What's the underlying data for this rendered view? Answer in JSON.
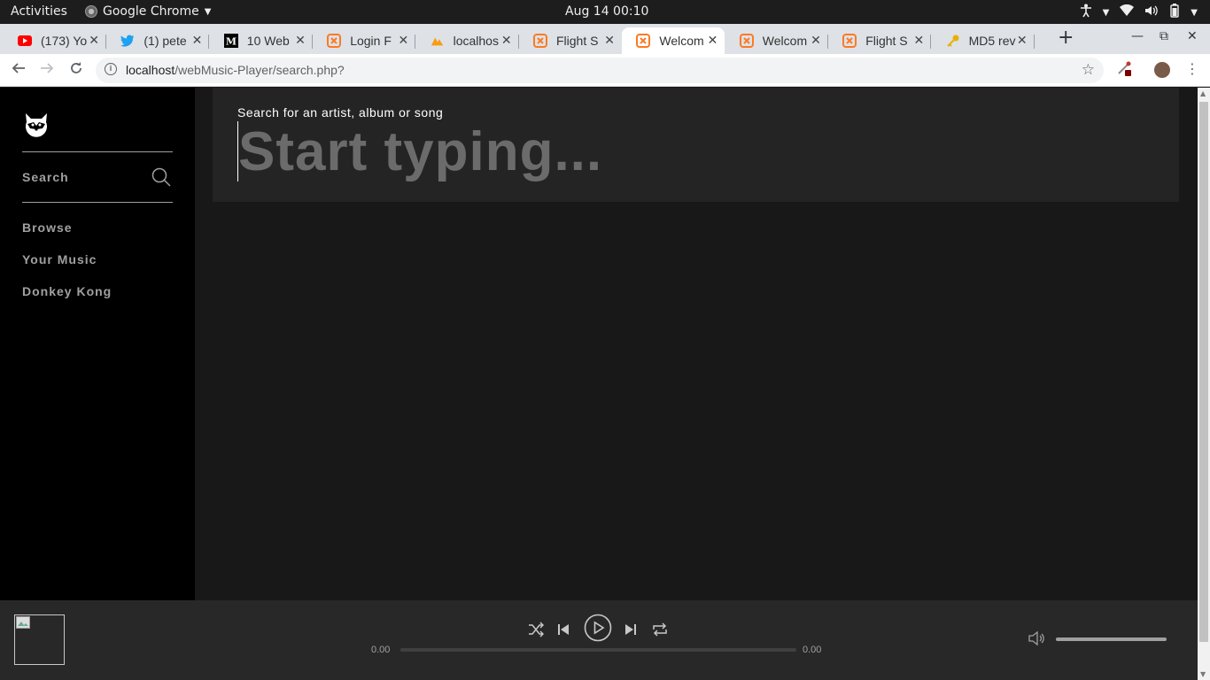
{
  "os": {
    "activities": "Activities",
    "app_name": "Google Chrome",
    "clock": "Aug 14  00:10"
  },
  "tabs": [
    {
      "title": "(173) Yo",
      "icon": "youtube-icon",
      "color": "#ff0000"
    },
    {
      "title": "(1) pete",
      "icon": "twitter-icon",
      "color": "#1da1f2"
    },
    {
      "title": "10 Web",
      "icon": "medium-icon",
      "color": "#000000"
    },
    {
      "title": "Login F",
      "icon": "xampp-icon",
      "color": "#fb7a24"
    },
    {
      "title": "localhos",
      "icon": "phpmyadmin-icon",
      "color": "#f89c0e"
    },
    {
      "title": "Flight S",
      "icon": "xampp-icon",
      "color": "#fb7a24"
    },
    {
      "title": "Welcom",
      "icon": "xampp-icon",
      "color": "#fb7a24",
      "active": true
    },
    {
      "title": "Welcom",
      "icon": "xampp-icon",
      "color": "#fb7a24"
    },
    {
      "title": "Flight S",
      "icon": "xampp-icon",
      "color": "#fb7a24"
    },
    {
      "title": "MD5 rev",
      "icon": "key-icon",
      "color": "#e8b100"
    }
  ],
  "omnibox": {
    "host": "localhost",
    "path": "/webMusic-Player/search.php?"
  },
  "sidebar": {
    "search_label": "Search",
    "nav": [
      {
        "label": "Browse"
      },
      {
        "label": "Your Music"
      },
      {
        "label": "Donkey Kong"
      }
    ]
  },
  "search": {
    "hint": "Search for an artist, album or song",
    "placeholder": "Start typing...",
    "value": ""
  },
  "player": {
    "time_current": "0.00",
    "time_remaining": "0.00",
    "progress": 0,
    "volume": 1.0
  },
  "colors": {
    "sidebar_bg": "#000000",
    "main_bg": "#181818",
    "search_bg": "#242424",
    "player_bg": "#282828",
    "link_gray": "#a0a0a0"
  }
}
